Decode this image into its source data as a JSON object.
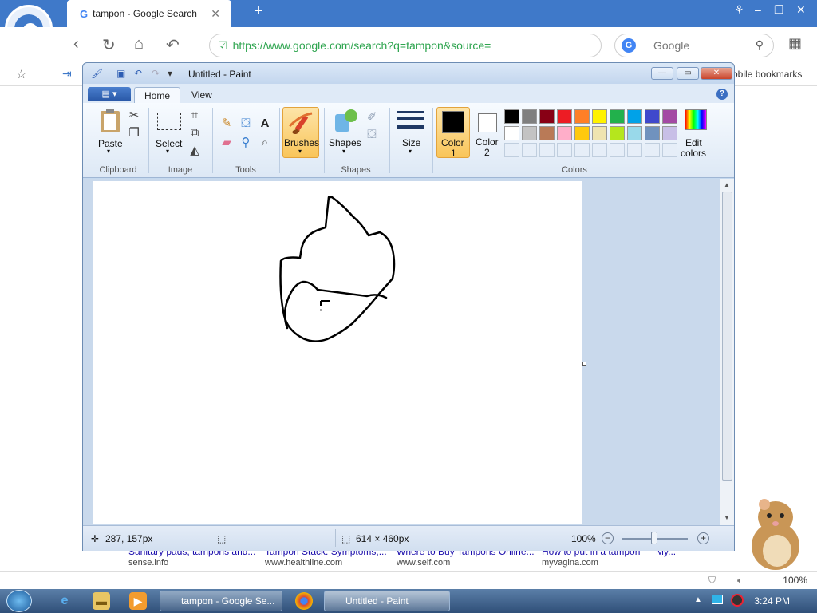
{
  "browser": {
    "tab_title": "tampon - Google Search",
    "url": "https://www.google.com/search?q=tampon&source=",
    "search_placeholder": "Google",
    "bookmarks_label": "obile bookmarks",
    "zoom": "100%"
  },
  "search_results": [
    {
      "title": "Sanitary pads, tampons and...",
      "url": "sense.info"
    },
    {
      "title": "Tampon Stack: Symptoms,...",
      "url": "www.healthline.com"
    },
    {
      "title": "Where to Buy Tampons Online...",
      "url": "www.self.com"
    },
    {
      "title": "How to put in a tampon",
      "url": "myvagina.com"
    },
    {
      "title": "My...",
      "url": ""
    }
  ],
  "paint": {
    "title": "Untitled - Paint",
    "tabs": [
      "Home",
      "View"
    ],
    "groups": {
      "clipboard": "Clipboard",
      "image": "Image",
      "tools": "Tools",
      "shapes": "Shapes",
      "colors": "Colors"
    },
    "buttons": {
      "paste": "Paste",
      "select": "Select",
      "brushes": "Brushes",
      "shapes": "Shapes",
      "size": "Size",
      "color1_line1": "Color",
      "color1_line2": "1",
      "color2_line1": "Color",
      "color2_line2": "2",
      "edit_colors_line1": "Edit",
      "edit_colors_line2": "colors"
    },
    "color1": "#000000",
    "color2": "#ffffff",
    "palette": [
      "#000000",
      "#7f7f7f",
      "#880015",
      "#ed1c24",
      "#ff7f27",
      "#fff200",
      "#22b14c",
      "#00a2e8",
      "#3f48cc",
      "#a349a4",
      "#ffffff",
      "#c3c3c3",
      "#b97a57",
      "#ffaec9",
      "#ffc90e",
      "#efe4b0",
      "#b5e61d",
      "#99d9ea",
      "#7092be",
      "#c8bfe7"
    ],
    "status": {
      "cursor_pos": "287, 157px",
      "canvas_size": "614 × 460px",
      "zoom": "100%"
    }
  },
  "taskbar": {
    "tasks": [
      "tampon - Google Se...",
      "Untitled - Paint"
    ],
    "clock": "3:24 PM"
  }
}
